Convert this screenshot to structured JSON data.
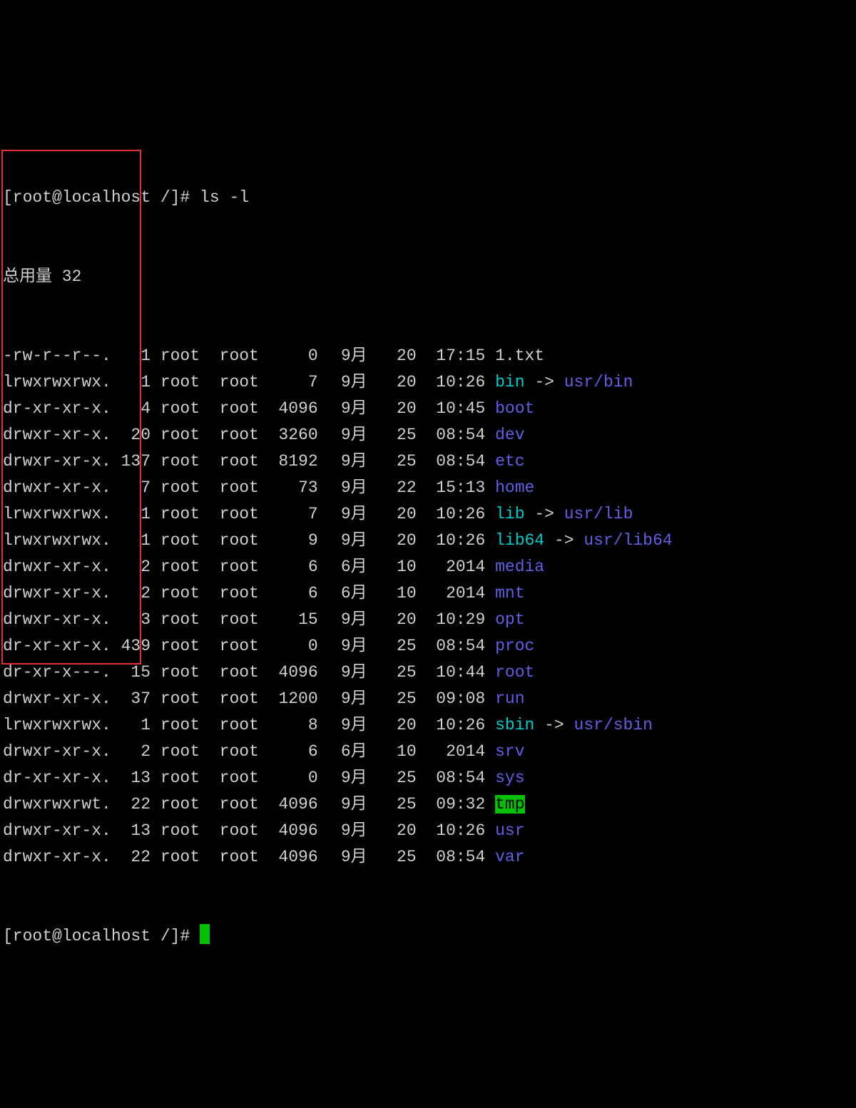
{
  "prompt1": "[root@localhost /]# ls -l",
  "total_line": "总用量 32",
  "prompt2": "[root@localhost /]# ",
  "rows": [
    {
      "perm": "-rw-r--r--.",
      "links": "1",
      "owner": "root",
      "group": "root",
      "size": "0",
      "month": "9月",
      "day": "20",
      "time": "17:15",
      "name": "1.txt",
      "name_class": "white",
      "target": null
    },
    {
      "perm": "lrwxrwxrwx.",
      "links": "1",
      "owner": "root",
      "group": "root",
      "size": "7",
      "month": "9月",
      "day": "20",
      "time": "10:26",
      "name": "bin",
      "name_class": "cyan",
      "target": "usr/bin"
    },
    {
      "perm": "dr-xr-xr-x.",
      "links": "4",
      "owner": "root",
      "group": "root",
      "size": "4096",
      "month": "9月",
      "day": "20",
      "time": "10:45",
      "name": "boot",
      "name_class": "blue",
      "target": null
    },
    {
      "perm": "drwxr-xr-x.",
      "links": "20",
      "owner": "root",
      "group": "root",
      "size": "3260",
      "month": "9月",
      "day": "25",
      "time": "08:54",
      "name": "dev",
      "name_class": "blue",
      "target": null
    },
    {
      "perm": "drwxr-xr-x.",
      "links": "137",
      "owner": "root",
      "group": "root",
      "size": "8192",
      "month": "9月",
      "day": "25",
      "time": "08:54",
      "name": "etc",
      "name_class": "blue",
      "target": null
    },
    {
      "perm": "drwxr-xr-x.",
      "links": "7",
      "owner": "root",
      "group": "root",
      "size": "73",
      "month": "9月",
      "day": "22",
      "time": "15:13",
      "name": "home",
      "name_class": "blue",
      "target": null
    },
    {
      "perm": "lrwxrwxrwx.",
      "links": "1",
      "owner": "root",
      "group": "root",
      "size": "7",
      "month": "9月",
      "day": "20",
      "time": "10:26",
      "name": "lib",
      "name_class": "cyan",
      "target": "usr/lib"
    },
    {
      "perm": "lrwxrwxrwx.",
      "links": "1",
      "owner": "root",
      "group": "root",
      "size": "9",
      "month": "9月",
      "day": "20",
      "time": "10:26",
      "name": "lib64",
      "name_class": "cyan",
      "target": "usr/lib64"
    },
    {
      "perm": "drwxr-xr-x.",
      "links": "2",
      "owner": "root",
      "group": "root",
      "size": "6",
      "month": "6月",
      "day": "10",
      "time": "2014",
      "name": "media",
      "name_class": "blue",
      "target": null
    },
    {
      "perm": "drwxr-xr-x.",
      "links": "2",
      "owner": "root",
      "group": "root",
      "size": "6",
      "month": "6月",
      "day": "10",
      "time": "2014",
      "name": "mnt",
      "name_class": "blue",
      "target": null
    },
    {
      "perm": "drwxr-xr-x.",
      "links": "3",
      "owner": "root",
      "group": "root",
      "size": "15",
      "month": "9月",
      "day": "20",
      "time": "10:29",
      "name": "opt",
      "name_class": "blue",
      "target": null
    },
    {
      "perm": "dr-xr-xr-x.",
      "links": "439",
      "owner": "root",
      "group": "root",
      "size": "0",
      "month": "9月",
      "day": "25",
      "time": "08:54",
      "name": "proc",
      "name_class": "blue",
      "target": null
    },
    {
      "perm": "dr-xr-x---.",
      "links": "15",
      "owner": "root",
      "group": "root",
      "size": "4096",
      "month": "9月",
      "day": "25",
      "time": "10:44",
      "name": "root",
      "name_class": "blue",
      "target": null
    },
    {
      "perm": "drwxr-xr-x.",
      "links": "37",
      "owner": "root",
      "group": "root",
      "size": "1200",
      "month": "9月",
      "day": "25",
      "time": "09:08",
      "name": "run",
      "name_class": "blue",
      "target": null
    },
    {
      "perm": "lrwxrwxrwx.",
      "links": "1",
      "owner": "root",
      "group": "root",
      "size": "8",
      "month": "9月",
      "day": "20",
      "time": "10:26",
      "name": "sbin",
      "name_class": "cyan",
      "target": "usr/sbin"
    },
    {
      "perm": "drwxr-xr-x.",
      "links": "2",
      "owner": "root",
      "group": "root",
      "size": "6",
      "month": "6月",
      "day": "10",
      "time": "2014",
      "name": "srv",
      "name_class": "blue",
      "target": null
    },
    {
      "perm": "dr-xr-xr-x.",
      "links": "13",
      "owner": "root",
      "group": "root",
      "size": "0",
      "month": "9月",
      "day": "25",
      "time": "08:54",
      "name": "sys",
      "name_class": "blue",
      "target": null
    },
    {
      "perm": "drwxrwxrwt.",
      "links": "22",
      "owner": "root",
      "group": "root",
      "size": "4096",
      "month": "9月",
      "day": "25",
      "time": "09:32",
      "name": "tmp",
      "name_class": "tmp",
      "target": null
    },
    {
      "perm": "drwxr-xr-x.",
      "links": "13",
      "owner": "root",
      "group": "root",
      "size": "4096",
      "month": "9月",
      "day": "20",
      "time": "10:26",
      "name": "usr",
      "name_class": "blue",
      "target": null
    },
    {
      "perm": "drwxr-xr-x.",
      "links": "22",
      "owner": "root",
      "group": "root",
      "size": "4096",
      "month": "9月",
      "day": "25",
      "time": "08:54",
      "name": "var",
      "name_class": "blue",
      "target": null
    }
  ]
}
